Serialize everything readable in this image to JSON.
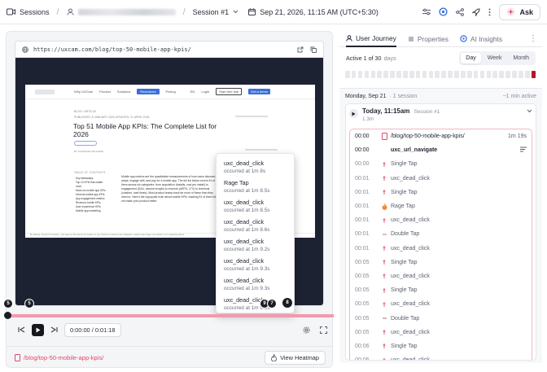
{
  "topbar": {
    "sessions_label": "Sessions",
    "session_label": "Session #1",
    "date_label": "Sep 21, 2026, 11:15 AM (UTC+5:30)",
    "ask_label": "Ask"
  },
  "player": {
    "url": "https://uxcam.com/blog/top-50-mobile-app-kpis/",
    "site": {
      "nav": [
        "Why UXCam",
        "Product",
        "Solutions",
        "Resources",
        "Pricing",
        "EN",
        "Login",
        "Start free trial",
        "Get a demo"
      ],
      "breadcrumb": "BLOG / ARTICLE",
      "meta": "PUBLISHED: 6 JANUARY 2026    UPDATED: 21 APRIL 2026",
      "title": "Top 51 Mobile App KPIs: The Complete List for 2026",
      "author": "BY JONATHAN WILLIAMS",
      "toc_label": "TABLE OF CONTENTS",
      "toc": [
        "Key takeaways",
        "Top 10 KPIs that matter most",
        "Must-run mobile app KPIs",
        "General mobile app KPIs",
        "App engagement metrics",
        "Revenue mobile KPIs",
        "User experience KPIs",
        "Mobile app marketing"
      ],
      "body": "Mobile app metrics are the quantitative measurements of how users discover, adopt, engage with, and pay for a mobile app. The full list below covers 51 of them across six categories: from acquisition (installs, cost per install) to engagement (DAU, session length) to revenue (ARPU, LTV) to technical (crashes, load times). Most product teams track far more of these than they need to.  Here's the unpopular truth about mobile KPIs: tracking 51 of them will not make your product better.",
      "footer": "By clicking \"Accept All Cookies\", you agree to the storing of cookies on your device to enhance site navigation, analyze site usage, and assist in our marketing efforts."
    },
    "events_popup": [
      {
        "name": "uxc_dead_click",
        "time": "occurred at 1m 8s"
      },
      {
        "name": "Rage Tap",
        "time": "occurred at 1m 8.5s"
      },
      {
        "name": "uxc_dead_click",
        "time": "occurred at 1m 8.5s"
      },
      {
        "name": "uxc_dead_click",
        "time": "occurred at 1m 8.6s"
      },
      {
        "name": "uxc_dead_click",
        "time": "occurred at 1m 9.2s"
      },
      {
        "name": "uxc_dead_click",
        "time": "occurred at 1m 9.3s"
      },
      {
        "name": "uxc_dead_click",
        "time": "occurred at 1m 9.3s"
      },
      {
        "name": "uxc_dead_click",
        "time": "occurred at 1m 9.5s"
      }
    ],
    "markers": [
      "5",
      "5",
      "9",
      "7",
      "8"
    ],
    "time_current": "0:00:00",
    "time_total": "0:01:18",
    "page_path": "/blog/top-50-mobile-app-kpis/",
    "heatmap_label": "View Heatmap"
  },
  "journey": {
    "tabs": [
      {
        "label": "User Journey",
        "active": true
      },
      {
        "label": "Properties",
        "active": false
      },
      {
        "label": "AI Insights",
        "active": false
      }
    ],
    "active_prefix": "Active 1 of 30",
    "active_suffix": "days",
    "ranges": [
      {
        "label": "Day",
        "on": true
      },
      {
        "label": "Week",
        "on": false
      },
      {
        "label": "Month",
        "on": false
      }
    ],
    "day_count": 30,
    "active_day_index": 29,
    "group": {
      "date": "Monday, Sep 21",
      "sessions": "1 session",
      "active": "~1 min active"
    },
    "session": {
      "title": "Today, 11:15am",
      "session_tag": "Session #1",
      "duration": "1.3m"
    },
    "events": [
      {
        "t": "00:00",
        "icon": "page-icon",
        "name": "/blog/top-50-mobile-app-kpis/",
        "style": "strong",
        "end": "1m 19s"
      },
      {
        "t": "00:00",
        "icon": "none",
        "name": "uxc_url_navigate",
        "style": "bold",
        "end": "filter"
      },
      {
        "t": "00:00",
        "icon": "tap-icon",
        "name": "Single Tap",
        "style": "",
        "end": ""
      },
      {
        "t": "00:01",
        "icon": "dead-click-icon",
        "name": "uxc_dead_click",
        "style": "",
        "end": ""
      },
      {
        "t": "00:01",
        "icon": "tap-icon",
        "name": "Single Tap",
        "style": "",
        "end": ""
      },
      {
        "t": "00:01",
        "icon": "rage-tap-icon",
        "name": "Rage Tap",
        "style": "",
        "end": ""
      },
      {
        "t": "00:01",
        "icon": "dead-click-icon",
        "name": "uxc_dead_click",
        "style": "",
        "end": ""
      },
      {
        "t": "00:01",
        "icon": "double-tap-icon",
        "name": "Double Tap",
        "style": "",
        "end": ""
      },
      {
        "t": "00:01",
        "icon": "dead-click-icon",
        "name": "uxc_dead_click",
        "style": "",
        "end": ""
      },
      {
        "t": "00:05",
        "icon": "tap-icon",
        "name": "Single Tap",
        "style": "",
        "end": ""
      },
      {
        "t": "00:05",
        "icon": "dead-click-icon",
        "name": "uxc_dead_click",
        "style": "",
        "end": ""
      },
      {
        "t": "00:05",
        "icon": "tap-icon",
        "name": "Single Tap",
        "style": "",
        "end": ""
      },
      {
        "t": "00:05",
        "icon": "dead-click-icon",
        "name": "uxc_dead_click",
        "style": "",
        "end": ""
      },
      {
        "t": "00:05",
        "icon": "double-tap-icon",
        "name": "Double Tap",
        "style": "",
        "end": ""
      },
      {
        "t": "00:05",
        "icon": "dead-click-icon",
        "name": "uxc_dead_click",
        "style": "",
        "end": ""
      },
      {
        "t": "00:06",
        "icon": "tap-icon",
        "name": "Single Tap",
        "style": "",
        "end": ""
      },
      {
        "t": "00:06",
        "icon": "dead-click-icon",
        "name": "uxc_dead_click",
        "style": "",
        "end": ""
      }
    ]
  },
  "colors": {
    "accent_pink": "#e0496c",
    "track": "#f09aae",
    "active_day": "#b5172a",
    "player_bg": "#1d2233"
  }
}
